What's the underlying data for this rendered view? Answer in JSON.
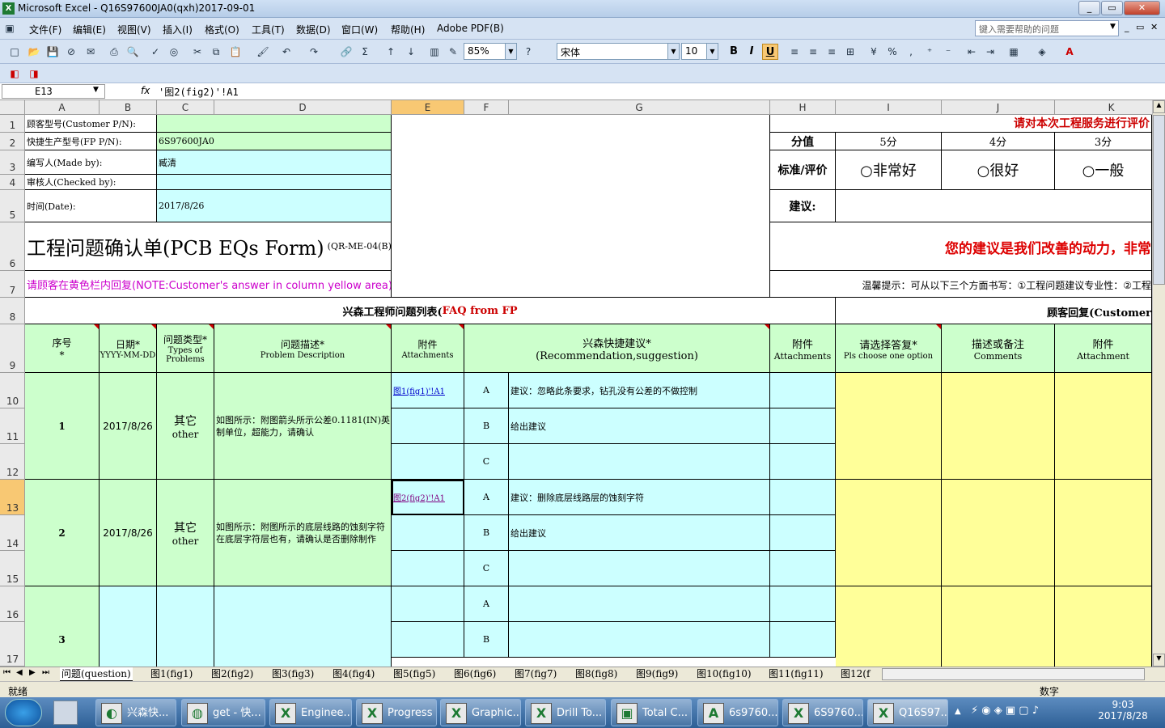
{
  "window": {
    "title": "Microsoft Excel - Q16S97600JA0(qxh)2017-09-01",
    "min": "_",
    "restore": "▭",
    "close": "✕"
  },
  "menu": {
    "items": [
      "文件(F)",
      "编辑(E)",
      "视图(V)",
      "插入(I)",
      "格式(O)",
      "工具(T)",
      "数据(D)",
      "窗口(W)",
      "帮助(H)",
      "Adobe PDF(B)"
    ],
    "help_placeholder": "键入需要帮助的问题"
  },
  "toolbar": {
    "zoom": "85%",
    "font": "宋体",
    "size": "10",
    "bold": "B",
    "italic": "I",
    "underline": "U"
  },
  "formula_bar": {
    "name_box": "E13",
    "fx": "fx",
    "formula": "'图2(fig2)'!A1"
  },
  "columns": [
    "A",
    "B",
    "C",
    "D",
    "E",
    "F",
    "G",
    "H",
    "I",
    "J",
    "K"
  ],
  "rows": [
    "1",
    "2",
    "3",
    "4",
    "5",
    "6",
    "7",
    "8",
    "9",
    "10",
    "11",
    "12",
    "13",
    "14",
    "15",
    "16",
    "17"
  ],
  "header_block": {
    "customer_pn_label": "顾客型号(Customer P/N):",
    "fp_pn_label": "快捷生产型号(FP P/N):",
    "fp_pn_value": "6S97600JA0",
    "made_by_label": "编写人(Made by):",
    "made_by_value": "臧清",
    "checked_by_label": "审核人(Checked by):",
    "date_label": "时间(Date):",
    "date_value": "2017/8/26",
    "form_title": "工程问题确认单(PCB EQs Form)",
    "form_code": "(QR-ME-04(B)",
    "note": "请顾客在黄色栏内回复(NOTE:Customer's answer in column yellow area)"
  },
  "rating": {
    "invite": "请对本次工程服务进行评价",
    "score_label": "分值",
    "scores": [
      "5分",
      "4分",
      "3分"
    ],
    "criteria_label": "标准/评价",
    "options": [
      "○非常好",
      "○很好",
      "○一般"
    ],
    "suggest_label": "建议:",
    "motivation": "您的建议是我们改善的动力，非常",
    "tip": "温馨提示：可从以下三个方面书写：①工程问题建议专业性：②工程"
  },
  "section": {
    "fp_title": "兴森工程师问题列表(",
    "fp_title_en": "FAQ from FP",
    ".close": ")",
    "cust_title": "顾客回复(Customer"
  },
  "table_headers": {
    "no": "序号",
    "no_star": "*",
    "date": "日期*",
    "date_fmt": "YYYY-MM-DD",
    "type": "问题类型*",
    "type_en": "Types of Problems",
    "desc": "问题描述*",
    "desc_en": "Problem Description",
    "att": "附件",
    "att_en": "Attachments",
    "rec": "兴森快捷建议*",
    "rec_en": "(Recommendation,suggestion)",
    "att2": "附件",
    "att2_en": "Attachments",
    "choose": "请选择答复*",
    "choose_en": "Pls choose one option",
    "comments": "描述或备注",
    "comments_en": "Comments",
    "att3": "附件",
    "att3_en": "Attachment"
  },
  "issues": [
    {
      "no": "1",
      "date": "2017/8/26",
      "type": "其它",
      "type_en": "other",
      "desc": "如图所示：附图箭头所示公差0.1181(IN)英制单位，超能力，请确认",
      "link": "图1(fig1)'!A1",
      "options": [
        {
          "k": "A",
          "t": "建议：忽略此条要求，钻孔没有公差的不做控制"
        },
        {
          "k": "B",
          "t": "给出建议"
        },
        {
          "k": "C",
          "t": ""
        }
      ]
    },
    {
      "no": "2",
      "date": "2017/8/26",
      "type": "其它",
      "type_en": "other",
      "desc": "如图所示：附图所示的底层线路的蚀刻字符在底层字符层也有，请确认是否删除制作",
      "link": "图2(fig2)'!A1",
      "options": [
        {
          "k": "A",
          "t": "建议：删除底层线路层的蚀刻字符"
        },
        {
          "k": "B",
          "t": "给出建议"
        },
        {
          "k": "C",
          "t": ""
        }
      ]
    },
    {
      "no": "3",
      "date": "",
      "type": "",
      "type_en": "",
      "desc": "",
      "link": "",
      "options": [
        {
          "k": "A",
          "t": ""
        },
        {
          "k": "B",
          "t": ""
        }
      ]
    }
  ],
  "sheets": [
    "问题(question)",
    "图1(fig1)",
    "图2(fig2)",
    "图3(fig3)",
    "图4(fig4)",
    "图5(fig5)",
    "图6(fig6)",
    "图7(fig7)",
    "图8(fig8)",
    "图9(fig9)",
    "图10(fig10)",
    "图11(fig11)",
    "图12(f"
  ],
  "status": {
    "left": "就绪",
    "mode": "数字"
  },
  "taskbar": {
    "items": [
      "兴森快...",
      "get - 快...",
      "Enginee...",
      "Progress",
      "Graphic...",
      "Drill To...",
      "Total C...",
      "6s9760...",
      "6S9760...",
      "Q16S97..."
    ],
    "time": "9:03",
    "date": "2017/8/28"
  }
}
